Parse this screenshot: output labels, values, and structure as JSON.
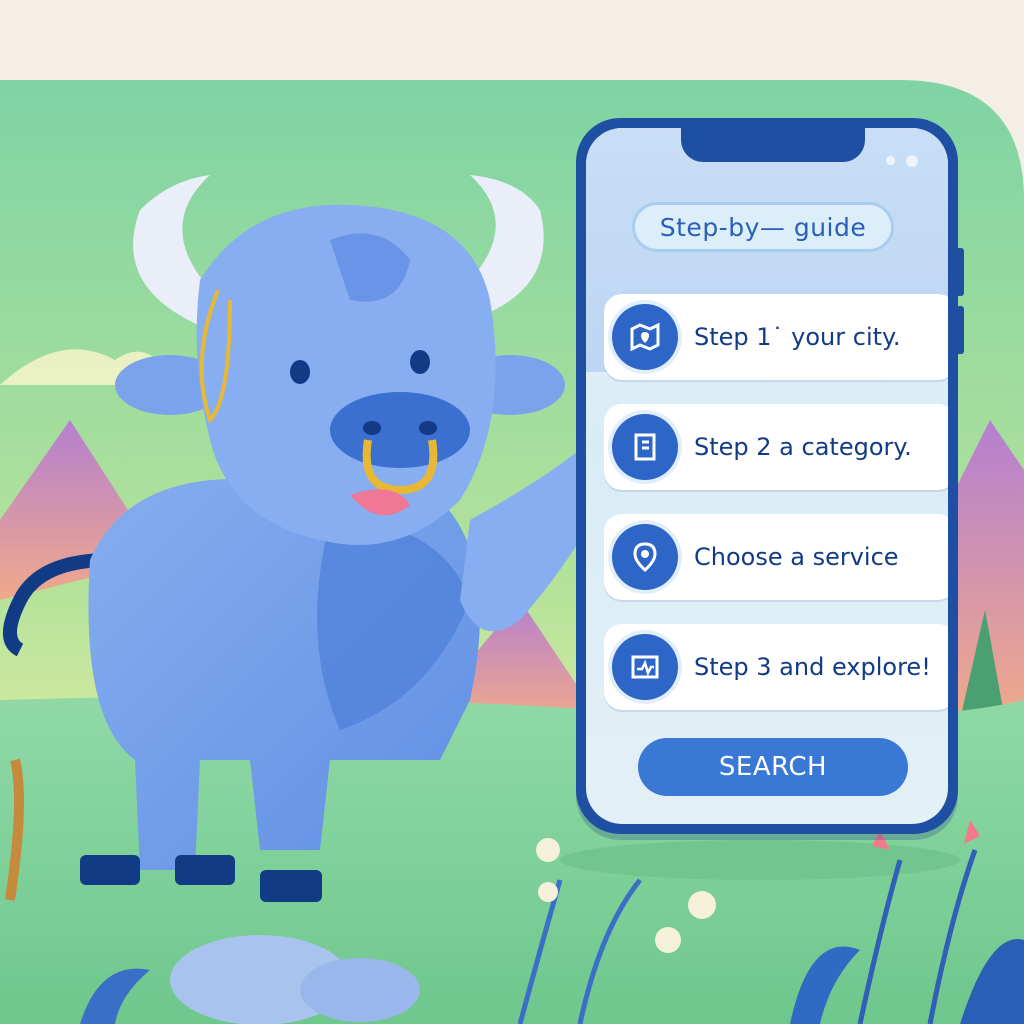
{
  "phone": {
    "guide_title": "Step-by— guide",
    "steps": [
      {
        "label": "Step 1˙ your city.",
        "icon": "map-icon"
      },
      {
        "label": "Step 2 a category.",
        "icon": "book-icon"
      },
      {
        "label": "Choose a service",
        "icon": "location-pin-icon"
      },
      {
        "label": "Step 3 and explore!",
        "icon": "map-chart-icon"
      }
    ],
    "search_label": "SEARCH"
  },
  "colors": {
    "phone_frame": "#1f4fa3",
    "accent": "#3a78d6",
    "step_text": "#123b86",
    "grass": "#7dcf95",
    "bull": "#6e9ae6"
  }
}
